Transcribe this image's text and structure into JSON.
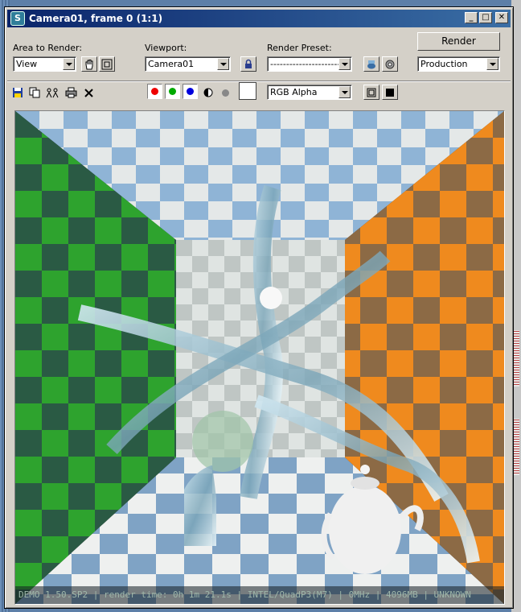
{
  "window": {
    "title": "Camera01, frame 0 (1:1)"
  },
  "controls": {
    "area_label": "Area to Render:",
    "area_value": "View",
    "viewport_label": "Viewport:",
    "viewport_value": "Camera01",
    "preset_label": "Render Preset:",
    "preset_value": "-------------------------",
    "render_label": "Render",
    "production_value": "Production"
  },
  "toolbar": {
    "channel_value": "RGB Alpha",
    "icons": [
      "save-icon",
      "copy-icon",
      "clone-icon",
      "print-icon",
      "clear-icon",
      "red-channel-icon",
      "green-channel-icon",
      "blue-channel-icon",
      "alpha-icon",
      "mono-icon"
    ]
  },
  "colors": {
    "title_start": "#0a246a",
    "title_end": "#3a6ea5",
    "wall_green": "#2f9e2f",
    "wall_orange": "#e8861f",
    "tile_blue": "#7fa6c9",
    "tile_white": "#e9ecec"
  },
  "status": {
    "text": "DEMO 1.50.SP2 | render time: 0h 1m 21.1s | INTEL/QuadP3(M7) | 0MHz | 4096MB | UNKNOWN"
  }
}
